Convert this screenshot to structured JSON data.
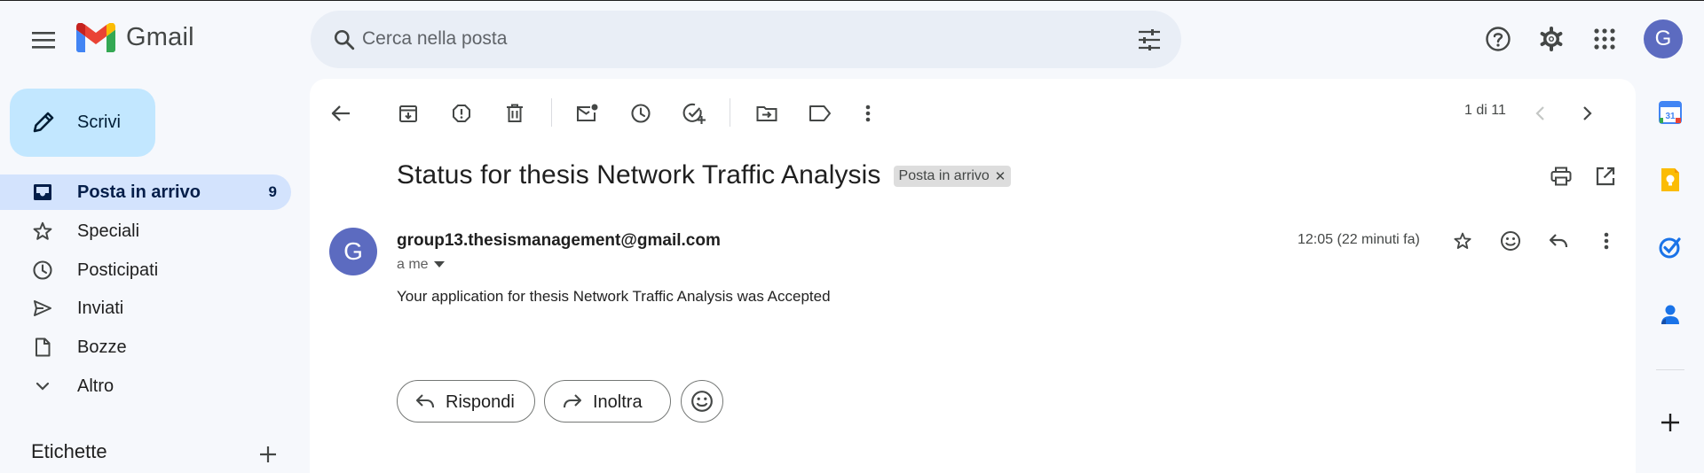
{
  "app": {
    "name": "Gmail",
    "avatar_letter": "G"
  },
  "search": {
    "placeholder": "Cerca nella posta"
  },
  "compose": {
    "label": "Scrivi"
  },
  "sidebar": {
    "items": [
      {
        "label": "Posta in arrivo",
        "count": "9",
        "icon": "inbox-icon"
      },
      {
        "label": "Speciali",
        "icon": "star-icon"
      },
      {
        "label": "Posticipati",
        "icon": "clock-icon"
      },
      {
        "label": "Inviati",
        "icon": "send-icon"
      },
      {
        "label": "Bozze",
        "icon": "draft-icon"
      },
      {
        "label": "Altro",
        "icon": "chevron-down-icon"
      }
    ],
    "labels_heading": "Etichette"
  },
  "toolbar": {
    "pager": "1 di 11"
  },
  "message": {
    "subject": "Status for thesis Network Traffic Analysis",
    "label_chip": "Posta in arrivo",
    "sender_initial": "G",
    "sender": "group13.thesismanagement@gmail.com",
    "to": "a me",
    "time": "12:05 (22 minuti fa)",
    "body": "Your application for thesis Network Traffic Analysis was Accepted"
  },
  "actions": {
    "reply": "Rispondi",
    "forward": "Inoltra"
  },
  "colors": {
    "accent": "#0b57d0",
    "compose_bg": "#c2e7ff",
    "active_nav": "#d3e3fd",
    "avatar": "#5c6bc0",
    "page_bg": "#f6f8fc"
  }
}
